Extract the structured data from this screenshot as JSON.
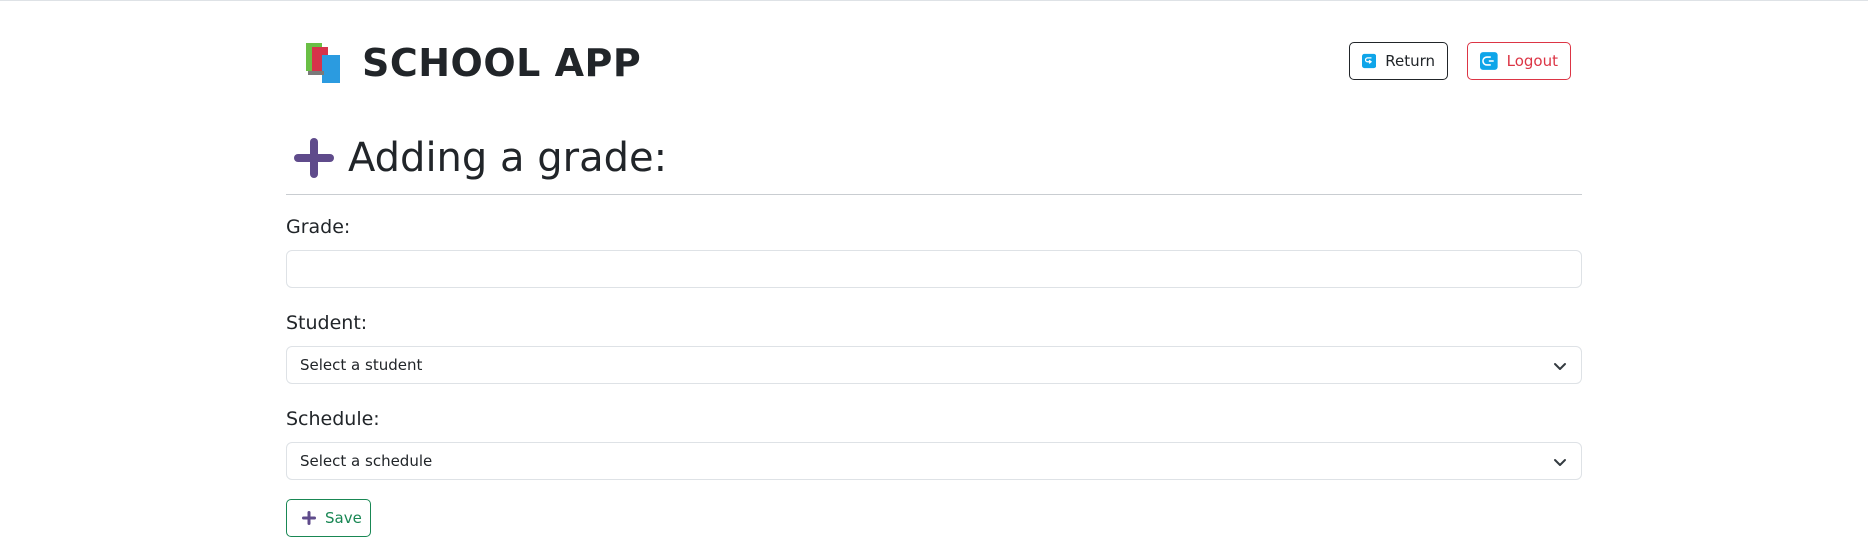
{
  "header": {
    "app_title": "SCHOOL APP",
    "return_label": "Return",
    "logout_label": "Logout"
  },
  "page": {
    "title": "Adding a grade:"
  },
  "form": {
    "grade_label": "Grade:",
    "grade_value": "",
    "student_label": "Student:",
    "student_selected": "Select a student",
    "schedule_label": "Schedule:",
    "schedule_selected": "Select a schedule",
    "save_label": "Save"
  },
  "icons": {
    "brand": "books-icon",
    "return": "return-arrow-icon",
    "logout": "logout-arrow-icon",
    "heading": "plus-icon",
    "select": "chevron-down-icon",
    "save": "plus-icon"
  },
  "colors": {
    "accent_purple": "#5f4b8b",
    "return_border": "#212529",
    "logout": "#dc3545",
    "save": "#198754",
    "icon_blue": "#0ea5e9"
  }
}
